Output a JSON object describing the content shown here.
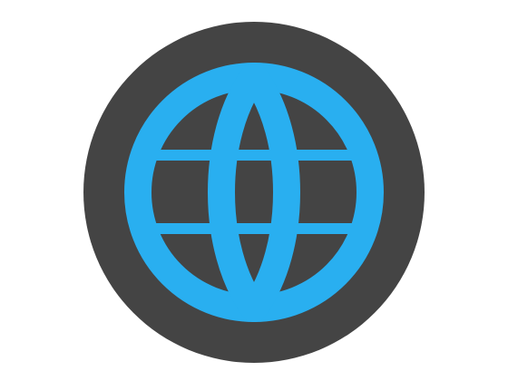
{
  "icon": {
    "name": "globe-icon",
    "colors": {
      "background": "#ffffff",
      "disc": "#444444",
      "globe": "#29aff0"
    }
  }
}
